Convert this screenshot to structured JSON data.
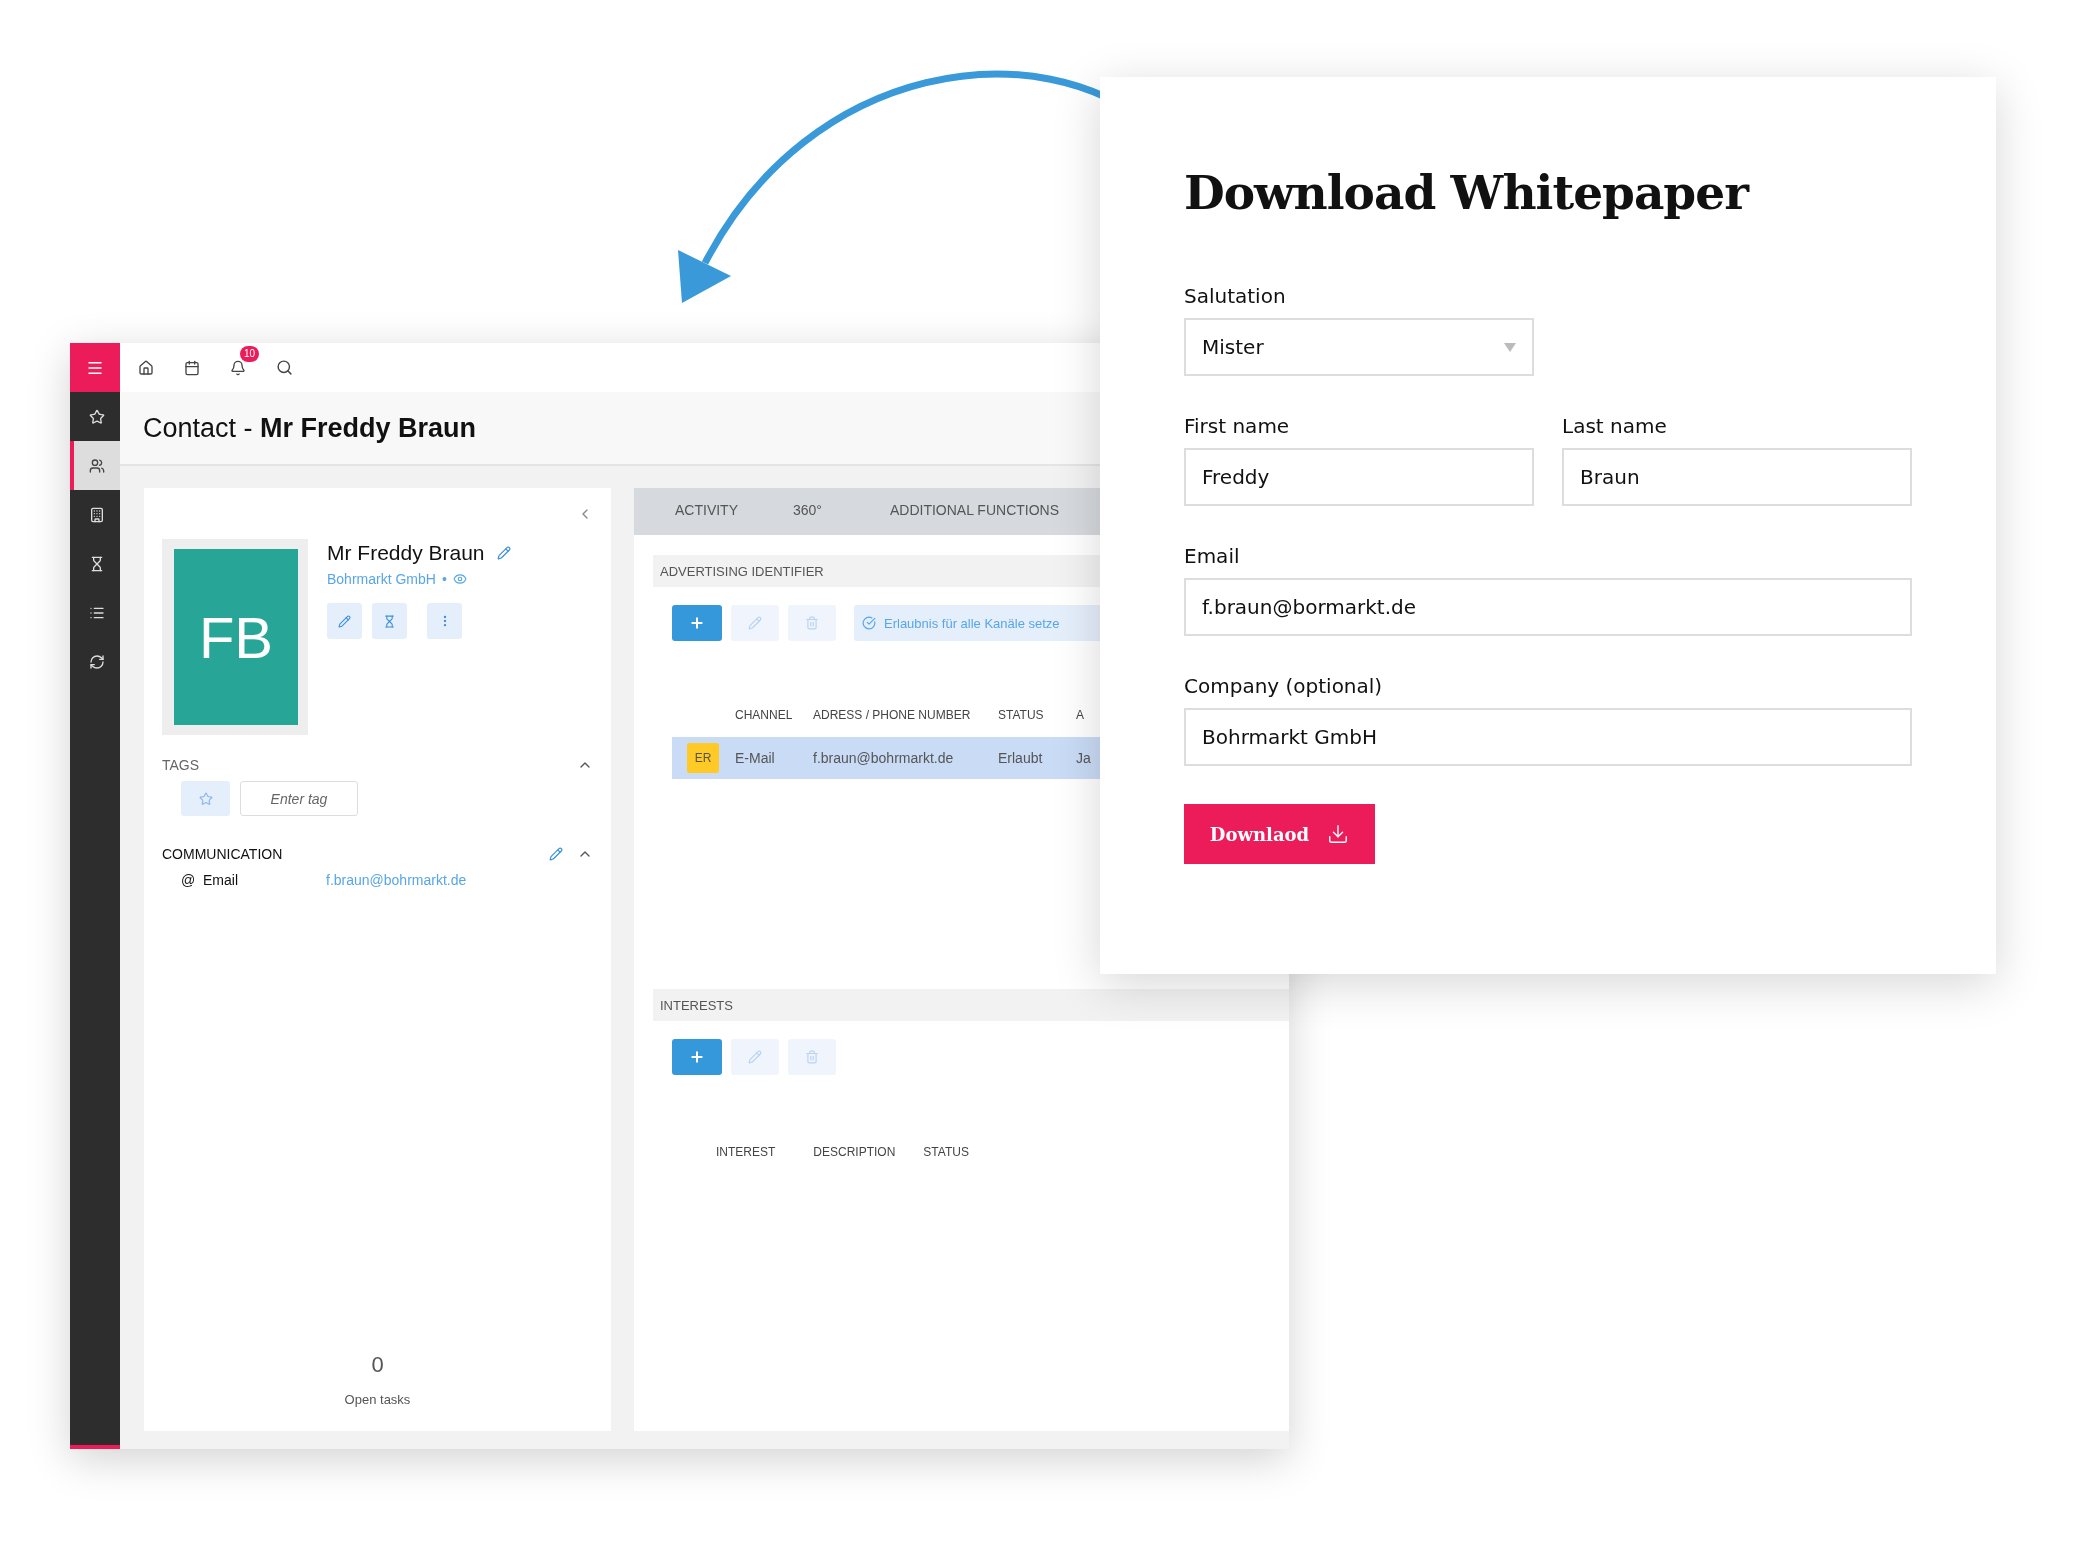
{
  "app": {
    "topbar": {
      "notification_count": "10"
    },
    "sidebar": {
      "items": [
        {
          "selected": false
        },
        {
          "selected": true
        },
        {
          "selected": false
        },
        {
          "selected": false
        },
        {
          "selected": false
        },
        {
          "selected": false
        }
      ]
    },
    "page_title": "Contact - **Mr Freddy Braun**",
    "contact_card": {
      "initials": "FB",
      "name": "Mr Freddy Braun",
      "company": "Bohrmarkt GmbH",
      "separator": "•",
      "tags": {
        "title": "TAGS",
        "expanded": true,
        "placeholder": "Enter tag"
      },
      "communication": {
        "title": "COMMUNICATION",
        "expanded": true,
        "entries": [
          {
            "symbol": "@",
            "label": "Email",
            "value": "f.braun@bohrmarkt.de"
          }
        ]
      },
      "open_tasks": {
        "count": "0",
        "label": "Open tasks"
      }
    },
    "tabs": [
      {
        "label": "ACTIVITY",
        "selected": false
      },
      {
        "label": "360°",
        "selected": false
      },
      {
        "label": "ADDITIONAL FUNCTIONS",
        "selected": false
      }
    ],
    "advertising": {
      "title": "ADVERTISING IDENTIFIER",
      "permission_button": "Erlaubnis für alle Kanäle setze",
      "columns": [
        "CHANNEL",
        "ADRESS / PHONE NUMBER",
        "STATUS",
        "A"
      ],
      "rows": [
        {
          "badge": "ER",
          "channel": "E-Mail",
          "address": "f.braun@bohrmarkt.de",
          "status": "Erlaubt",
          "column_4": "Ja",
          "selected": true
        }
      ]
    },
    "interests": {
      "title": "INTERESTS",
      "columns": [
        "INTEREST",
        "DESCRIPTION",
        "STATUS"
      ]
    }
  },
  "whitepaper_form": {
    "title": "Download Whitepaper",
    "rows": [
      [
        {
          "kind": "select",
          "label": "Salutation",
          "value": "Mister"
        }
      ],
      [
        {
          "kind": "text",
          "label": "First name",
          "value": "Freddy"
        },
        {
          "kind": "text",
          "label": "Last name",
          "value": "Braun"
        }
      ],
      [
        {
          "kind": "text",
          "label": "Email",
          "value": "f.braun@bormarkt.de"
        }
      ],
      [
        {
          "kind": "text",
          "label": "Company (optional)",
          "value": "Bohrmarkt GmbH"
        }
      ]
    ],
    "button": "Downlaod"
  }
}
